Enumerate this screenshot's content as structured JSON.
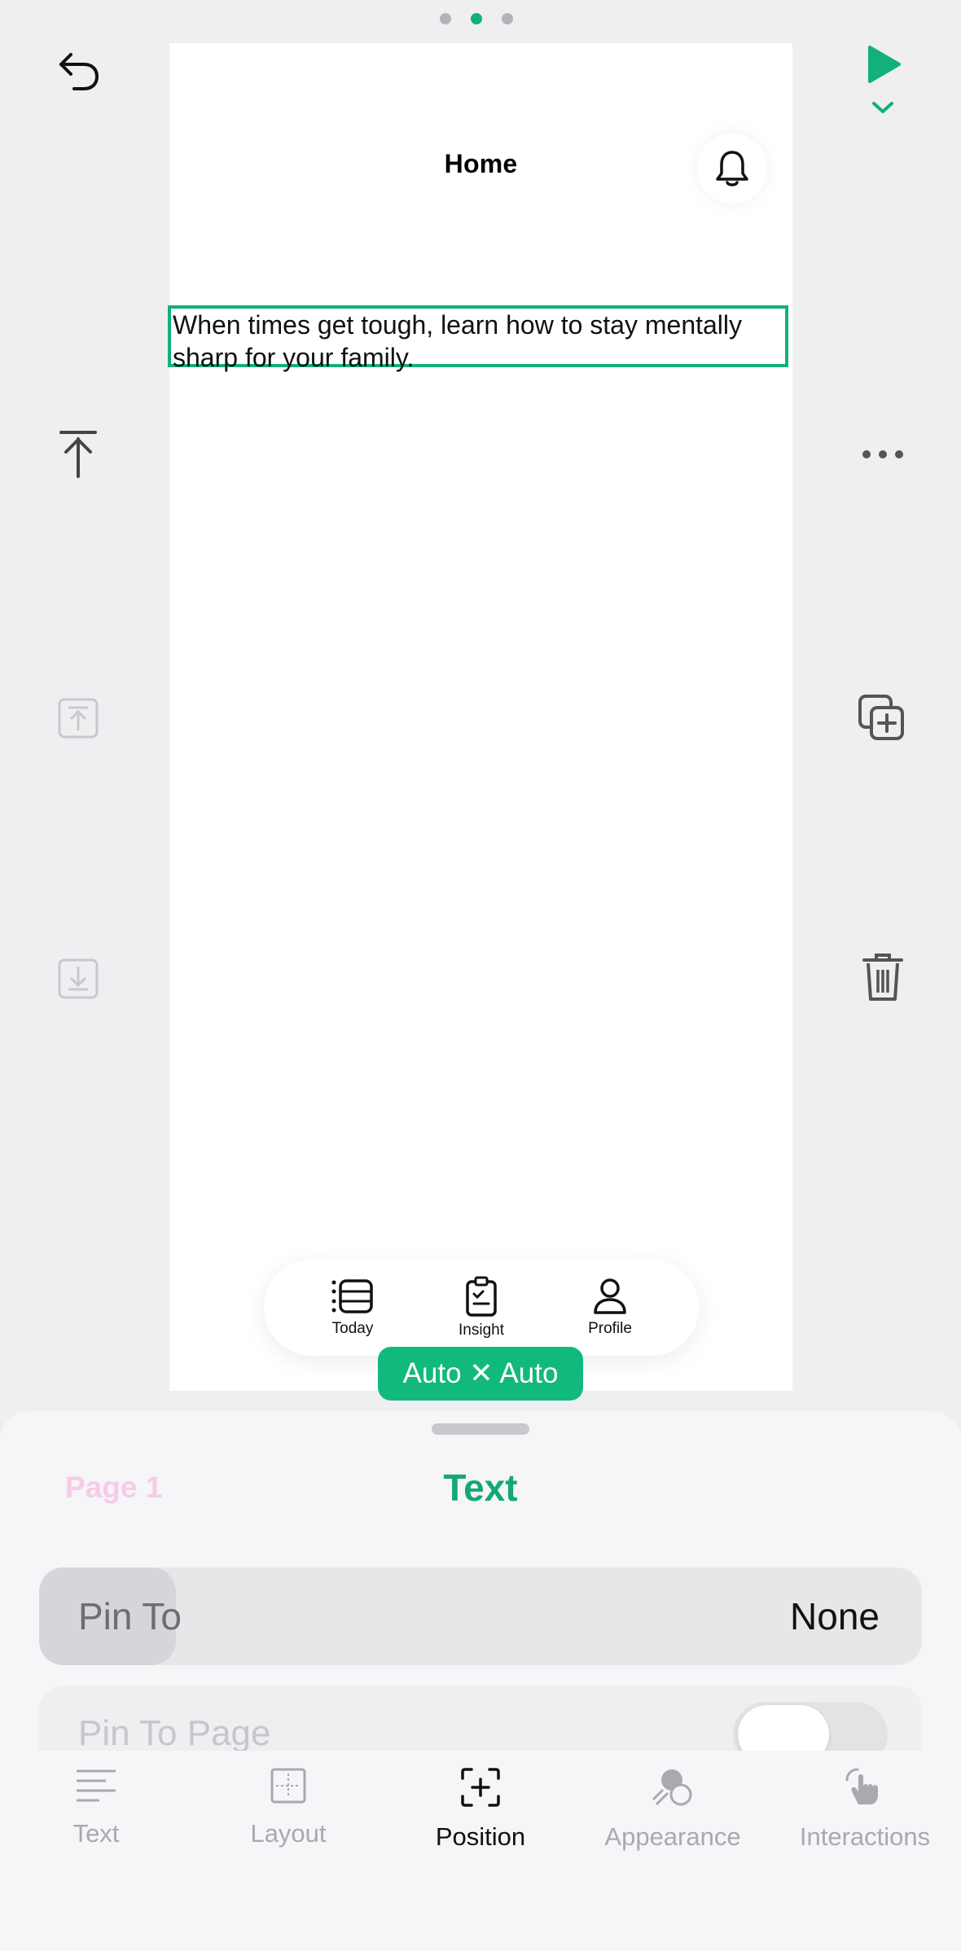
{
  "pager": {
    "dots": 3,
    "active_index": 1
  },
  "toolbar": {
    "undo": "undo-icon",
    "play": "play-icon",
    "more": "more-icon"
  },
  "canvas": {
    "header_title": "Home",
    "selected_text_line1": "When times get tough, learn how to stay mentally",
    "selected_text_line2": "sharp for your family.",
    "tabs": [
      {
        "label": "Today",
        "icon": "list-icon"
      },
      {
        "label": "Insight",
        "icon": "clipboard-icon"
      },
      {
        "label": "Profile",
        "icon": "person-icon"
      }
    ]
  },
  "size_badge": "Auto ✕ Auto",
  "sheet": {
    "crumb": "Page 1",
    "title": "Text",
    "pin_to": {
      "label": "Pin To",
      "value": "None"
    },
    "pin_to_page": {
      "label": "Pin To Page",
      "enabled": false
    }
  },
  "bottom_tabs": [
    {
      "label": "Text",
      "icon": "text-lines-icon"
    },
    {
      "label": "Layout",
      "icon": "layout-icon"
    },
    {
      "label": "Position",
      "icon": "position-icon",
      "active": true
    },
    {
      "label": "Appearance",
      "icon": "appearance-icon"
    },
    {
      "label": "Interactions",
      "icon": "hand-tap-icon"
    }
  ],
  "colors": {
    "accent": "#12b07a",
    "canvas_bg": "#ffffff",
    "app_bg": "#efeff2"
  }
}
